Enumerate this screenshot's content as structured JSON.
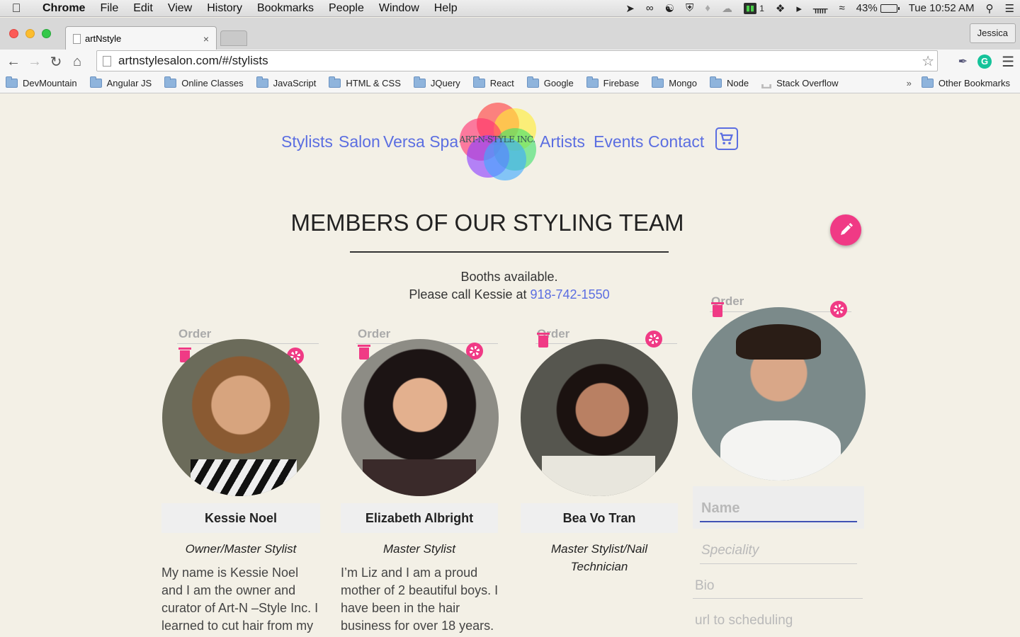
{
  "menubar": {
    "items": [
      "Chrome",
      "File",
      "Edit",
      "View",
      "History",
      "Bookmarks",
      "People",
      "Window",
      "Help"
    ],
    "battery": "43%",
    "notif_count": "1",
    "clock": "Tue 10:52 AM"
  },
  "browser": {
    "tab_title": "artNstyle",
    "tab_close": "×",
    "profile_name": "Jessica",
    "url": "artnstylesalon.com/#/stylists",
    "bookmarks": [
      "DevMountain",
      "Angular JS",
      "Online Classes",
      "JavaScript",
      "HTML & CSS",
      "JQuery",
      "React",
      "Google",
      "Firebase",
      "Mongo",
      "Node",
      "Stack Overflow"
    ],
    "bookmarks_more": "»",
    "other_bookmarks": "Other Bookmarks",
    "extension_letter": "G"
  },
  "site": {
    "nav": [
      "Stylists",
      "Salon",
      "Versa Spa",
      "Artists",
      "Events",
      "Contact"
    ],
    "logo_text": "ART-N-STYLE INC.",
    "headline": "MEMBERS OF OUR STYLING TEAM",
    "booths_line1": "Booths available.",
    "booths_line2": "Please call Kessie at",
    "phone": "918-742-1550",
    "order_label": "Order",
    "stylists": [
      {
        "name": "Kessie Noel",
        "role": "Owner/Master Stylist",
        "bio": "My name is Kessie Noel and I am the owner and curator of Art-N –Style Inc. I learned to cut hair from my"
      },
      {
        "name": "Elizabeth Albright",
        "role": "Master Stylist",
        "bio": "I’m Liz and I am a proud mother of 2 beautiful boys. I have been in the hair business for over 18 years. I"
      },
      {
        "name": "Bea Vo Tran",
        "role": "Master Stylist/Nail Technician",
        "bio": ""
      }
    ],
    "new_stylist_form": {
      "name_placeholder": "Name",
      "speciality_placeholder": "Speciality",
      "bio_placeholder": "Bio",
      "url_placeholder": "url to scheduling"
    }
  },
  "colors": {
    "accent_pink": "#f03a85",
    "link_blue": "#5b6ee1",
    "page_bg": "#f3f0e6"
  }
}
